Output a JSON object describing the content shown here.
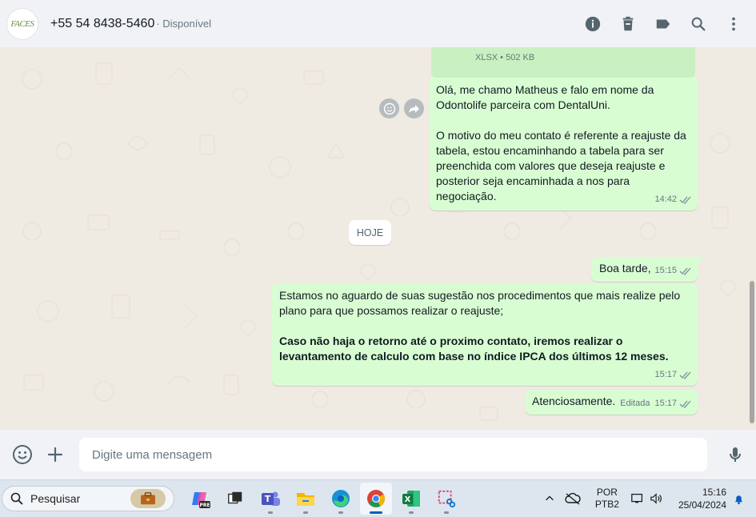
{
  "contact": {
    "avatar_text": "FACES",
    "name": "+55 54 8438-5460",
    "status": "· Disponível"
  },
  "header_icons": [
    "info-icon",
    "trash-icon",
    "label-icon",
    "search-icon",
    "menu-icon"
  ],
  "attachment": {
    "meta": "XLSX • 502 KB"
  },
  "messages": [
    {
      "paragraphs": [
        "Olá, me chamo Matheus e falo em nome da Odontolife parceira com DentalUni.",
        "O motivo do meu contato é referente a reajuste da tabela, estou encaminhando a tabela para ser preenchida com valores que deseja reajuste e posterior seja encaminhada a nos para negociação."
      ],
      "time": "14:42"
    },
    {
      "text": "Boa tarde,",
      "time": "15:15"
    },
    {
      "text": "Estamos no aguardo de suas sugestão nos procedimentos que mais realize pelo plano para que possamos realizar o reajuste;",
      "bold": "Caso não haja o retorno até o proximo contato, iremos realizar o levantamento de calculo com base no índice IPCA dos últimos 12 meses.",
      "time": "15:17"
    },
    {
      "text": "Atenciosamente.",
      "edited": "Editada",
      "time": "15:17"
    }
  ],
  "date_divider": "HOJE",
  "composer": {
    "placeholder": "Digite uma mensagem"
  },
  "taskbar": {
    "search_label": "Pesquisar",
    "lang_top": "POR",
    "lang_bottom": "PTB2",
    "time": "15:16",
    "date": "25/04/2024",
    "copilot_badge": "PRE"
  },
  "colors": {
    "outgoing_bubble": "#d9fdd3",
    "chat_background": "#efeae2",
    "header_background": "#f0f2f5",
    "tick_color": "#8696a0"
  }
}
